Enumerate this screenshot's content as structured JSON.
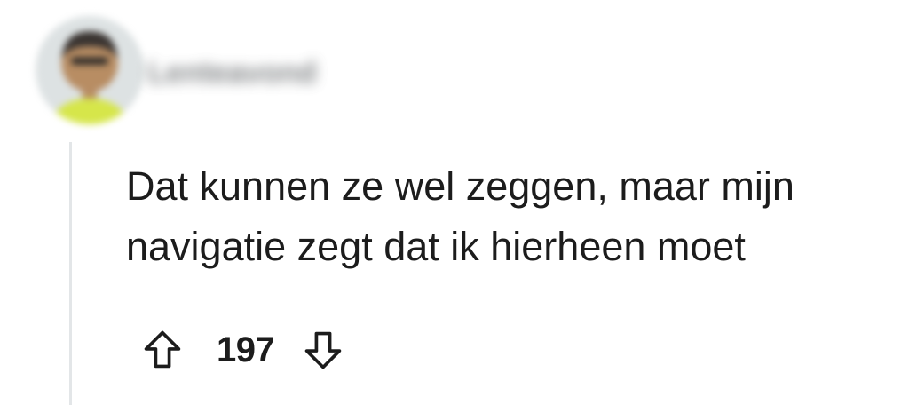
{
  "comment": {
    "author": "Lenteavond",
    "avatar": "avatar-icon",
    "text_lines": [
      "Dat kunnen ze wel zeggen, maar mijn",
      "navigatie zegt dat ik hierheen moet"
    ],
    "score": "197",
    "upvote_icon": "arrow-up-icon",
    "downvote_icon": "arrow-down-icon"
  },
  "colors": {
    "text": "#1c1c1c",
    "thread_line": "#e3e6e8",
    "background": "#ffffff"
  }
}
